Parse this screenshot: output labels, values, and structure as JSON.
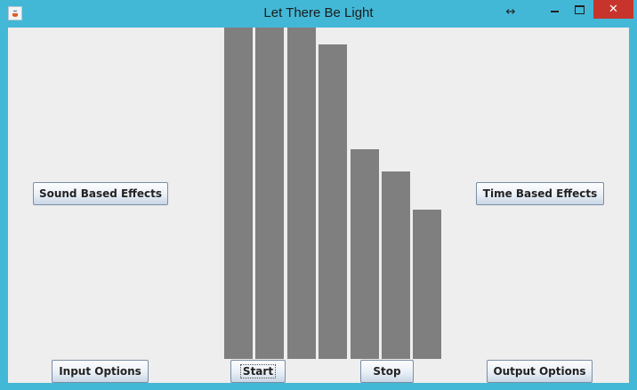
{
  "window": {
    "title": "Let There Be Light",
    "controls": {
      "resize_glyph": "↔",
      "close_glyph": "✕"
    }
  },
  "buttons": {
    "sound_based_effects": "Sound Based Effects",
    "time_based_effects": "Time Based Effects",
    "input_options": "Input Options",
    "start": "Start",
    "stop": "Stop",
    "output_options": "Output Options"
  },
  "visualizer": {
    "bar_color": "#7f7f7f",
    "levels": [
      1.0,
      1.0,
      1.0,
      0.949,
      0.634,
      0.567,
      0.451
    ]
  },
  "colors": {
    "frame": "#43b8d6",
    "close": "#c7342c",
    "client_bg": "#eeeeee"
  }
}
